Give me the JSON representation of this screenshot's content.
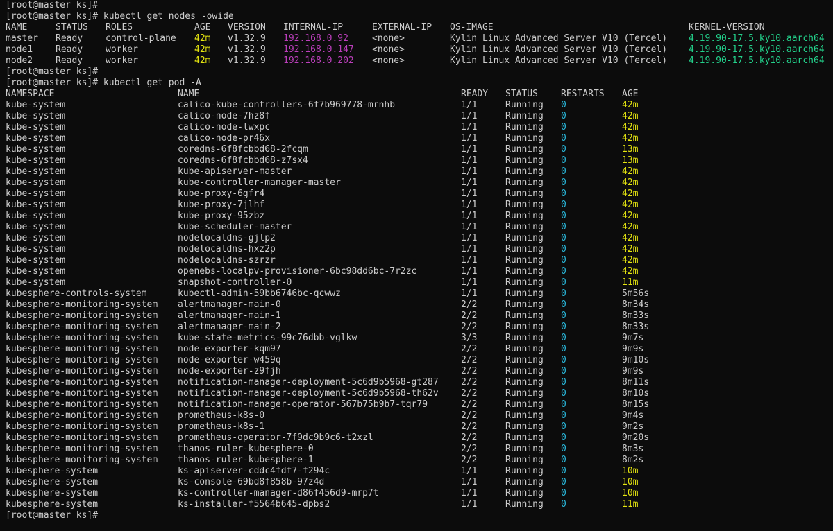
{
  "colors": {
    "background": "#0c0c0c",
    "foreground": "#cccccc",
    "age": "#e5e510",
    "ip": "#bc3fbc",
    "kernel": "#23d18b",
    "cyan": "#29b8db",
    "cursor": "#e01b24"
  },
  "prompt": "[root@master ks]#",
  "lines": [
    {
      "kind": "prompt",
      "cmd": ""
    },
    {
      "kind": "prompt",
      "cmd": " kubectl get nodes -owide"
    },
    {
      "kind": "nodehead",
      "cells": [
        "NAME",
        "STATUS",
        "ROLES",
        "AGE",
        "VERSION",
        "INTERNAL-IP",
        "EXTERNAL-IP",
        "OS-IMAGE",
        "KERNEL-VERSION"
      ]
    },
    {
      "kind": "node",
      "cells": [
        "master",
        "Ready",
        "control-plane",
        "42m",
        "v1.32.9",
        "192.168.0.92",
        "<none>",
        "Kylin Linux Advanced Server V10 (Tercel)",
        "4.19.90-17.5.ky10.aarch64"
      ]
    },
    {
      "kind": "node",
      "cells": [
        "node1",
        "Ready",
        "worker",
        "42m",
        "v1.32.9",
        "192.168.0.147",
        "<none>",
        "Kylin Linux Advanced Server V10 (Tercel)",
        "4.19.90-17.5.ky10.aarch64"
      ]
    },
    {
      "kind": "node",
      "cells": [
        "node2",
        "Ready",
        "worker",
        "42m",
        "v1.32.9",
        "192.168.0.202",
        "<none>",
        "Kylin Linux Advanced Server V10 (Tercel)",
        "4.19.90-17.5.ky10.aarch64"
      ]
    },
    {
      "kind": "prompt",
      "cmd": ""
    },
    {
      "kind": "prompt",
      "cmd": " kubectl get pod -A"
    },
    {
      "kind": "podhead",
      "cells": [
        "NAMESPACE",
        "NAME",
        "READY",
        "STATUS",
        "RESTARTS",
        "AGE"
      ]
    },
    {
      "kind": "pod",
      "cells": [
        "kube-system",
        "calico-kube-controllers-6f7b969778-mrnhb",
        "1/1",
        "Running",
        "0",
        "42m"
      ]
    },
    {
      "kind": "pod",
      "cells": [
        "kube-system",
        "calico-node-7hz8f",
        "1/1",
        "Running",
        "0",
        "42m"
      ]
    },
    {
      "kind": "pod",
      "cells": [
        "kube-system",
        "calico-node-lwxpc",
        "1/1",
        "Running",
        "0",
        "42m"
      ]
    },
    {
      "kind": "pod",
      "cells": [
        "kube-system",
        "calico-node-pr46x",
        "1/1",
        "Running",
        "0",
        "42m"
      ]
    },
    {
      "kind": "pod",
      "cells": [
        "kube-system",
        "coredns-6f8fcbbd68-2fcqm",
        "1/1",
        "Running",
        "0",
        "13m"
      ]
    },
    {
      "kind": "pod",
      "cells": [
        "kube-system",
        "coredns-6f8fcbbd68-z7sx4",
        "1/1",
        "Running",
        "0",
        "13m"
      ]
    },
    {
      "kind": "pod",
      "cells": [
        "kube-system",
        "kube-apiserver-master",
        "1/1",
        "Running",
        "0",
        "42m"
      ]
    },
    {
      "kind": "pod",
      "cells": [
        "kube-system",
        "kube-controller-manager-master",
        "1/1",
        "Running",
        "0",
        "42m"
      ]
    },
    {
      "kind": "pod",
      "cells": [
        "kube-system",
        "kube-proxy-6gfr4",
        "1/1",
        "Running",
        "0",
        "42m"
      ]
    },
    {
      "kind": "pod",
      "cells": [
        "kube-system",
        "kube-proxy-7jlhf",
        "1/1",
        "Running",
        "0",
        "42m"
      ]
    },
    {
      "kind": "pod",
      "cells": [
        "kube-system",
        "kube-proxy-95zbz",
        "1/1",
        "Running",
        "0",
        "42m"
      ]
    },
    {
      "kind": "pod",
      "cells": [
        "kube-system",
        "kube-scheduler-master",
        "1/1",
        "Running",
        "0",
        "42m"
      ]
    },
    {
      "kind": "pod",
      "cells": [
        "kube-system",
        "nodelocaldns-gjlp2",
        "1/1",
        "Running",
        "0",
        "42m"
      ]
    },
    {
      "kind": "pod",
      "cells": [
        "kube-system",
        "nodelocaldns-hxz2p",
        "1/1",
        "Running",
        "0",
        "42m"
      ]
    },
    {
      "kind": "pod",
      "cells": [
        "kube-system",
        "nodelocaldns-szrzr",
        "1/1",
        "Running",
        "0",
        "42m"
      ]
    },
    {
      "kind": "pod",
      "cells": [
        "kube-system",
        "openebs-localpv-provisioner-6bc98dd6bc-7r2zc",
        "1/1",
        "Running",
        "0",
        "42m"
      ]
    },
    {
      "kind": "pod",
      "cells": [
        "kube-system",
        "snapshot-controller-0",
        "1/1",
        "Running",
        "0",
        "11m"
      ]
    },
    {
      "kind": "pod",
      "cells": [
        "kubesphere-controls-system",
        "kubectl-admin-59bb6746bc-qcwwz",
        "1/1",
        "Running",
        "0",
        "5m56s"
      ]
    },
    {
      "kind": "pod",
      "cells": [
        "kubesphere-monitoring-system",
        "alertmanager-main-0",
        "2/2",
        "Running",
        "0",
        "8m34s"
      ]
    },
    {
      "kind": "pod",
      "cells": [
        "kubesphere-monitoring-system",
        "alertmanager-main-1",
        "2/2",
        "Running",
        "0",
        "8m33s"
      ]
    },
    {
      "kind": "pod",
      "cells": [
        "kubesphere-monitoring-system",
        "alertmanager-main-2",
        "2/2",
        "Running",
        "0",
        "8m33s"
      ]
    },
    {
      "kind": "pod",
      "cells": [
        "kubesphere-monitoring-system",
        "kube-state-metrics-99c76dbb-vglkw",
        "3/3",
        "Running",
        "0",
        "9m7s"
      ]
    },
    {
      "kind": "pod",
      "cells": [
        "kubesphere-monitoring-system",
        "node-exporter-kqm97",
        "2/2",
        "Running",
        "0",
        "9m9s"
      ]
    },
    {
      "kind": "pod",
      "cells": [
        "kubesphere-monitoring-system",
        "node-exporter-w459q",
        "2/2",
        "Running",
        "0",
        "9m10s"
      ]
    },
    {
      "kind": "pod",
      "cells": [
        "kubesphere-monitoring-system",
        "node-exporter-z9fjh",
        "2/2",
        "Running",
        "0",
        "9m9s"
      ]
    },
    {
      "kind": "pod",
      "cells": [
        "kubesphere-monitoring-system",
        "notification-manager-deployment-5c6d9b5968-gt287",
        "2/2",
        "Running",
        "0",
        "8m11s"
      ]
    },
    {
      "kind": "pod",
      "cells": [
        "kubesphere-monitoring-system",
        "notification-manager-deployment-5c6d9b5968-th62v",
        "2/2",
        "Running",
        "0",
        "8m10s"
      ]
    },
    {
      "kind": "pod",
      "cells": [
        "kubesphere-monitoring-system",
        "notification-manager-operator-567b75b9b7-tqr79",
        "2/2",
        "Running",
        "0",
        "8m15s"
      ]
    },
    {
      "kind": "pod",
      "cells": [
        "kubesphere-monitoring-system",
        "prometheus-k8s-0",
        "2/2",
        "Running",
        "0",
        "9m4s"
      ]
    },
    {
      "kind": "pod",
      "cells": [
        "kubesphere-monitoring-system",
        "prometheus-k8s-1",
        "2/2",
        "Running",
        "0",
        "9m2s"
      ]
    },
    {
      "kind": "pod",
      "cells": [
        "kubesphere-monitoring-system",
        "prometheus-operator-7f9dc9b9c6-t2xzl",
        "2/2",
        "Running",
        "0",
        "9m20s"
      ]
    },
    {
      "kind": "pod",
      "cells": [
        "kubesphere-monitoring-system",
        "thanos-ruler-kubesphere-0",
        "2/2",
        "Running",
        "0",
        "8m3s"
      ]
    },
    {
      "kind": "pod",
      "cells": [
        "kubesphere-monitoring-system",
        "thanos-ruler-kubesphere-1",
        "2/2",
        "Running",
        "0",
        "8m2s"
      ]
    },
    {
      "kind": "pod",
      "cells": [
        "kubesphere-system",
        "ks-apiserver-cddc4fdf7-f294c",
        "1/1",
        "Running",
        "0",
        "10m"
      ]
    },
    {
      "kind": "pod",
      "cells": [
        "kubesphere-system",
        "ks-console-69bd8f858b-97z4d",
        "1/1",
        "Running",
        "0",
        "10m"
      ]
    },
    {
      "kind": "pod",
      "cells": [
        "kubesphere-system",
        "ks-controller-manager-d86f456d9-mrp7t",
        "1/1",
        "Running",
        "0",
        "10m"
      ]
    },
    {
      "kind": "pod",
      "cells": [
        "kubesphere-system",
        "ks-installer-f5564b645-dpbs2",
        "1/1",
        "Running",
        "0",
        "11m"
      ]
    },
    {
      "kind": "prompt",
      "cmd": "",
      "cursor": true
    }
  ]
}
